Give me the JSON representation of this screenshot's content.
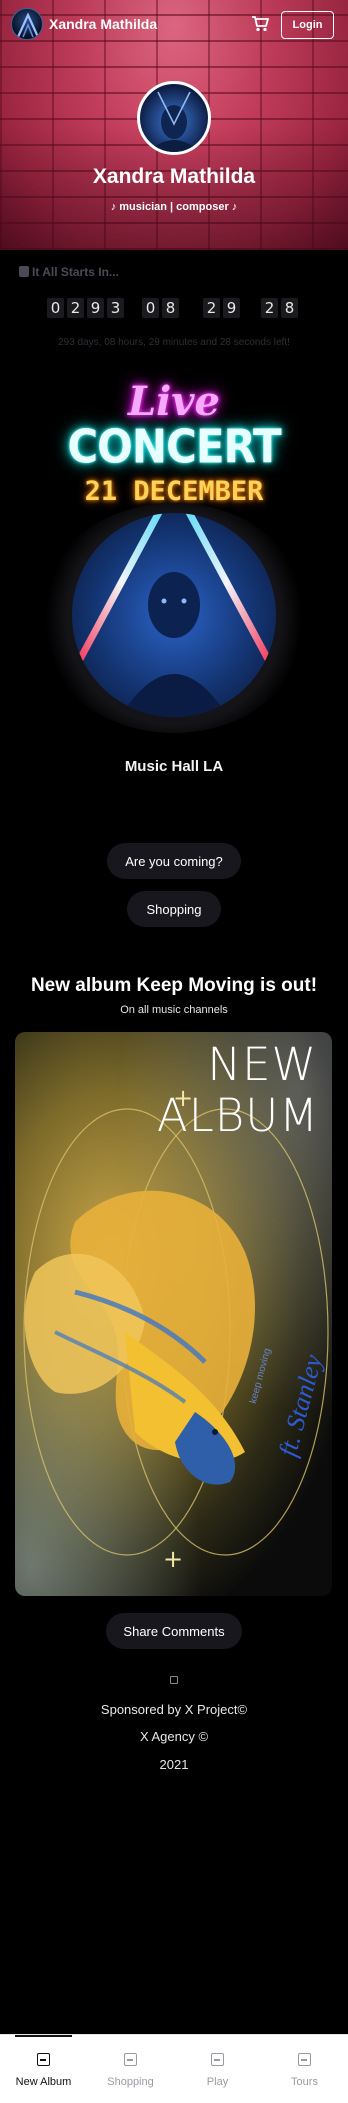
{
  "header": {
    "brand": "Xandra Mathilda",
    "login_label": "Login",
    "icons": {
      "logo": "artist-logo-icon",
      "cart": "cart-icon"
    }
  },
  "hero": {
    "name": "Xandra Mathilda",
    "role": "♪ musician | composer ♪"
  },
  "countdown": {
    "title": "It All Starts In...",
    "digits": [
      "0",
      "2",
      "9",
      "3",
      "0",
      "8",
      "2",
      "9",
      "2",
      "8"
    ],
    "text": "293 days, 08 hours, 29 minutes and 28 seconds left!"
  },
  "concert": {
    "line1": "Live",
    "line2": "CONCERT",
    "line3": "21 DECEMBER",
    "venue": "Music Hall LA"
  },
  "buttons": {
    "coming": "Are you coming?",
    "shopping": "Shopping",
    "share": "Share Comments"
  },
  "album": {
    "title": "New album Keep Moving is out!",
    "subtitle": "On all music channels",
    "cover": {
      "new": "NEW",
      "album": "ALBUM",
      "keep_moving": "keep moving",
      "ft": "ft. Stanley"
    }
  },
  "footer": {
    "icon": "music-note-icon",
    "sponsor": "Sponsored by X Project©",
    "agency": "X Agency  ©",
    "year": "2021"
  },
  "nav": {
    "items": [
      {
        "label": "New Album",
        "icon": "album-icon",
        "active": true
      },
      {
        "label": "Shopping",
        "icon": "shopping-icon",
        "active": false
      },
      {
        "label": "Play",
        "icon": "play-icon",
        "active": false
      },
      {
        "label": "Tours",
        "icon": "tours-icon",
        "active": false
      }
    ]
  },
  "colors": {
    "hero_brick": "#c33d5c",
    "live_neon": "#ff4dff",
    "concert_neon": "#00cccc",
    "date_neon": "#ffd25a",
    "pill_bg": "#17171d"
  }
}
